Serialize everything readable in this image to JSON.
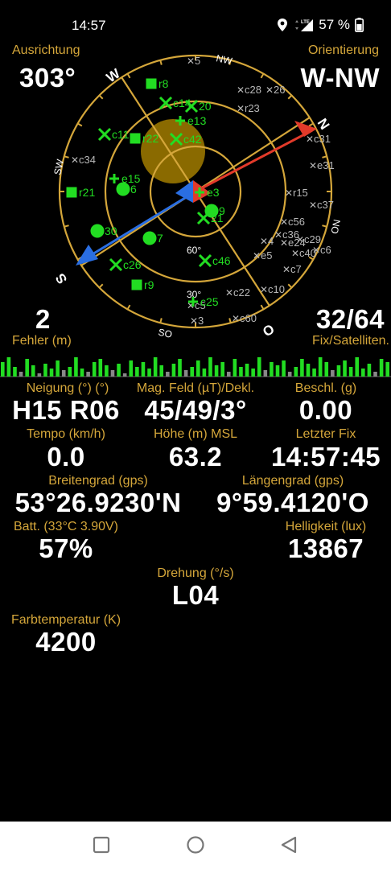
{
  "status_bar": {
    "time": "14:57",
    "network": "LTE",
    "battery_text": "57 %"
  },
  "compass": {
    "heading_label": "Ausrichtung",
    "heading_value": "303°",
    "orientation_label": "Orientierung",
    "orientation_value": "W-NW",
    "cardinals": {
      "n": "N",
      "nw": "NW",
      "w": "W",
      "sw": "SW",
      "s": "S",
      "so": "SO",
      "o": "O",
      "no": "NO"
    },
    "ring_labels": {
      "r60": "60°",
      "r30": "30°"
    }
  },
  "satellites": {
    "used": [
      {
        "id": "r8"
      },
      {
        "id": "c14"
      },
      {
        "id": "c11"
      },
      {
        "id": "r22"
      },
      {
        "id": "e15"
      },
      {
        "id": "r21"
      },
      {
        "id": "30"
      },
      {
        "id": "7"
      },
      {
        "id": "c26"
      },
      {
        "id": "r9"
      },
      {
        "id": "e3"
      },
      {
        "id": "21"
      },
      {
        "id": "c46"
      },
      {
        "id": "c25"
      },
      {
        "id": "20"
      },
      {
        "id": "e13"
      },
      {
        "id": "c42"
      },
      {
        "id": "6"
      },
      {
        "id": "9"
      }
    ],
    "unused": [
      {
        "id": "5"
      },
      {
        "id": "c28"
      },
      {
        "id": "26"
      },
      {
        "id": "r23"
      },
      {
        "id": "c31"
      },
      {
        "id": "c34"
      },
      {
        "id": "e31"
      },
      {
        "id": "r15"
      },
      {
        "id": "c56"
      },
      {
        "id": "c36"
      },
      {
        "id": "e24"
      },
      {
        "id": "c29"
      },
      {
        "id": "c40"
      },
      {
        "id": "c6"
      },
      {
        "id": "c7"
      },
      {
        "id": "c10"
      },
      {
        "id": "c22"
      },
      {
        "id": "c5"
      },
      {
        "id": "3"
      },
      {
        "id": "c60"
      },
      {
        "id": "c37"
      },
      {
        "id": "4"
      },
      {
        "id": "e5"
      }
    ]
  },
  "error": {
    "value": "2",
    "label": "Fehler (m)"
  },
  "fix": {
    "value": "32/64",
    "label": "Fix/Satelliten."
  },
  "signal_bars": [
    18,
    24,
    12,
    6,
    22,
    14,
    4,
    16,
    10,
    20,
    8,
    12,
    24,
    10,
    6,
    18,
    22,
    14,
    8,
    16,
    4,
    20,
    12,
    18,
    10,
    24,
    14,
    6,
    16,
    22,
    8,
    12,
    20,
    10,
    24,
    14,
    18,
    6,
    22,
    12,
    16,
    10,
    24,
    8,
    18,
    14,
    20,
    6,
    12,
    22,
    16,
    10,
    24,
    18,
    8,
    14,
    20,
    12,
    24,
    10,
    16,
    6,
    22,
    18
  ],
  "readouts": {
    "neigung": {
      "label": "Neigung (°) (°)",
      "value": "H15 R06"
    },
    "magfeld": {
      "label": "Mag. Feld (µT)/Dekl.",
      "value": "45/49/3°"
    },
    "beschl": {
      "label": "Beschl. (g)",
      "value": "0.00"
    },
    "tempo": {
      "label": "Tempo (km/h)",
      "value": "0.0"
    },
    "hoehe": {
      "label": "Höhe (m) MSL",
      "value": "63.2"
    },
    "letzter_fix": {
      "label": "Letzter Fix",
      "value": "14:57:45"
    },
    "breitengrad": {
      "label": "Breitengrad (gps)",
      "value": "53°26.9230'N"
    },
    "laengengrad": {
      "label": "Längengrad (gps)",
      "value": "9°59.4120'O"
    },
    "batt": {
      "label": "Batt. (33°C 3.90V)",
      "value": "57%"
    },
    "helligkeit": {
      "label": "Helligkeit (lux)",
      "value": "13867"
    },
    "drehung": {
      "label": "Drehung (°/s)",
      "value": "L04"
    },
    "farbtemp": {
      "label": "Farbtemperatur (K)",
      "value": "4200"
    }
  },
  "colors": {
    "accent": "#d4a63a",
    "sat_used": "#22dd22",
    "sat_unused": "#b8b8b8",
    "sun": "#8a6a00",
    "north": "#e23a2a",
    "south": "#2a6ee2"
  },
  "nav_icons": [
    "recents-square-icon",
    "home-circle-icon",
    "back-triangle-icon"
  ]
}
